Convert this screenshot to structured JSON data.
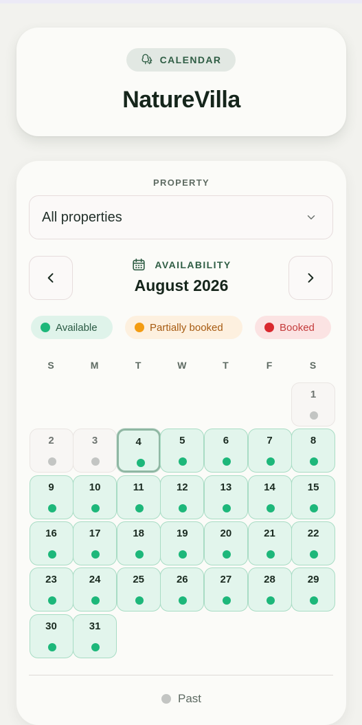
{
  "header": {
    "badge_label": "CALENDAR",
    "badge_icon": "trees-icon",
    "app_title": "NatureVilla"
  },
  "property": {
    "label": "PROPERTY",
    "selected": "All properties"
  },
  "calendar": {
    "section_label": "AVAILABILITY",
    "month_title": "August 2026",
    "prev_icon": "chevron-left-icon",
    "next_icon": "chevron-right-icon"
  },
  "legend": {
    "available": "Available",
    "partial": "Partially booked",
    "booked": "Booked",
    "past": "Past"
  },
  "colors": {
    "accent": "#2f5d44",
    "available": "#1db77a",
    "partial": "#f39c12",
    "booked": "#d9292f",
    "past": "#c3c5c3"
  },
  "weekdays": [
    "S",
    "M",
    "T",
    "W",
    "T",
    "F",
    "S"
  ],
  "first_weekday_index": 6,
  "days": [
    {
      "day": "1",
      "status": "past"
    },
    {
      "day": "2",
      "status": "past"
    },
    {
      "day": "3",
      "status": "past"
    },
    {
      "day": "4",
      "status": "available",
      "today": true
    },
    {
      "day": "5",
      "status": "available"
    },
    {
      "day": "6",
      "status": "available"
    },
    {
      "day": "7",
      "status": "available"
    },
    {
      "day": "8",
      "status": "available"
    },
    {
      "day": "9",
      "status": "available"
    },
    {
      "day": "10",
      "status": "available"
    },
    {
      "day": "11",
      "status": "available"
    },
    {
      "day": "12",
      "status": "available"
    },
    {
      "day": "13",
      "status": "available"
    },
    {
      "day": "14",
      "status": "available"
    },
    {
      "day": "15",
      "status": "available"
    },
    {
      "day": "16",
      "status": "available"
    },
    {
      "day": "17",
      "status": "available"
    },
    {
      "day": "18",
      "status": "available"
    },
    {
      "day": "19",
      "status": "available"
    },
    {
      "day": "20",
      "status": "available"
    },
    {
      "day": "21",
      "status": "available"
    },
    {
      "day": "22",
      "status": "available"
    },
    {
      "day": "23",
      "status": "available"
    },
    {
      "day": "24",
      "status": "available"
    },
    {
      "day": "25",
      "status": "available"
    },
    {
      "day": "26",
      "status": "available"
    },
    {
      "day": "27",
      "status": "available"
    },
    {
      "day": "28",
      "status": "available"
    },
    {
      "day": "29",
      "status": "available"
    },
    {
      "day": "30",
      "status": "available"
    },
    {
      "day": "31",
      "status": "available"
    }
  ]
}
